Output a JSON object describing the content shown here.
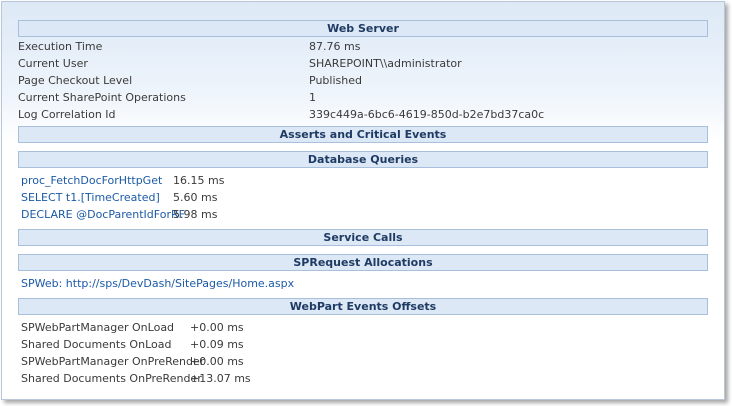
{
  "sections": {
    "web_server": {
      "title": "Web Server",
      "rows": [
        {
          "label": "Execution Time",
          "value": "87.76 ms"
        },
        {
          "label": "Current User",
          "value": "SHAREPOINT\\\\administrator"
        },
        {
          "label": "Page Checkout Level",
          "value": "Published"
        },
        {
          "label": "Current SharePoint Operations",
          "value": "1"
        },
        {
          "label": "Log Correlation Id",
          "value": "339c449a-6bc6-4619-850d-b2e7bd37ca0c"
        }
      ]
    },
    "asserts": {
      "title": "Asserts and Critical Events"
    },
    "database_queries": {
      "title": "Database Queries",
      "rows": [
        {
          "query": "proc_FetchDocForHttpGet",
          "time": "16.15 ms"
        },
        {
          "query": "SELECT t1.[TimeCreated]",
          "time": "5.60 ms"
        },
        {
          "query": "DECLARE @DocParentIdForRF",
          "time": "5.98 ms"
        }
      ]
    },
    "service_calls": {
      "title": "Service Calls"
    },
    "sprequest": {
      "title": "SPRequest Allocations",
      "link": "SPWeb: http://sps/DevDash/SitePages/Home.aspx"
    },
    "webpart_events": {
      "title": "WebPart Events Offsets",
      "rows": [
        {
          "event": "SPWebPartManager OnLoad",
          "offset": "+0.00 ms"
        },
        {
          "event": "Shared Documents OnLoad",
          "offset": "+0.09 ms"
        },
        {
          "event": "SPWebPartManager OnPreRender",
          "offset": "+0.00 ms"
        },
        {
          "event": "Shared Documents OnPreRender",
          "offset": "+13.07 ms"
        }
      ]
    }
  }
}
